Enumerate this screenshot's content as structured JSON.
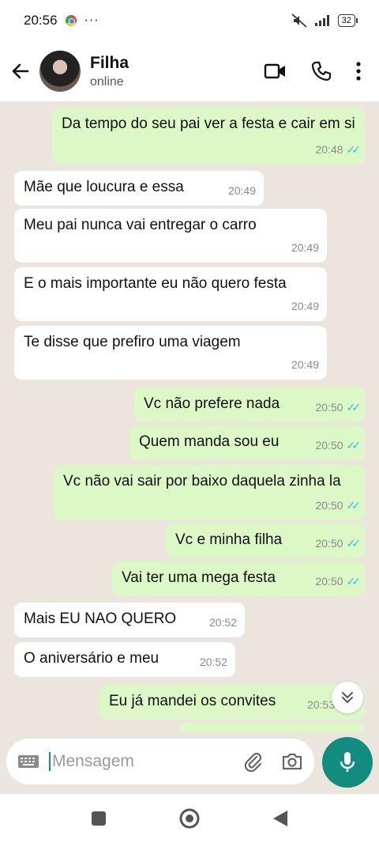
{
  "status_bar": {
    "time": "20:56",
    "dots": "···",
    "battery": "32"
  },
  "header": {
    "contact_name": "Filha",
    "contact_status": "online"
  },
  "messages": [
    {
      "dir": "out",
      "text": "Da tempo do seu pai ver a festa e cair em si",
      "time": "20:48",
      "ticks": "✓✓"
    },
    {
      "dir": "in",
      "text": "Mãe que loucura e essa",
      "time": "20:49"
    },
    {
      "dir": "in",
      "text": "Meu pai nunca vai entregar o carro",
      "time": "20:49"
    },
    {
      "dir": "in",
      "text": "E o mais importante eu não quero festa",
      "time": "20:49"
    },
    {
      "dir": "in",
      "text": "Te disse que prefiro uma viagem",
      "time": "20:49"
    },
    {
      "dir": "out",
      "text": "Vc não prefere nada",
      "time": "20:50",
      "ticks": "✓✓"
    },
    {
      "dir": "out",
      "text": "Quem manda sou eu",
      "time": "20:50",
      "ticks": "✓✓"
    },
    {
      "dir": "out",
      "text": "Vc não vai sair por baixo daquela zinha la",
      "time": "20:50",
      "ticks": "✓✓"
    },
    {
      "dir": "out",
      "text": "Vc e minha filha",
      "time": "20:50",
      "ticks": "✓✓"
    },
    {
      "dir": "out",
      "text": "Vai ter uma mega festa",
      "time": "20:50",
      "ticks": "✓✓"
    },
    {
      "dir": "in",
      "text": "Mais EU NAO QUERO",
      "time": "20:52"
    },
    {
      "dir": "in",
      "text": "O aniversário e meu",
      "time": "20:52"
    },
    {
      "dir": "out",
      "text": "Eu já mandei os convites",
      "time": "20:53"
    }
  ],
  "composer": {
    "placeholder": "Mensagem"
  },
  "colors": {
    "accent": "#128c7e",
    "outgoing": "#dcf8c6",
    "incoming": "#ffffff",
    "tick": "#34b7f1",
    "chat_bg": "#ece5dd"
  }
}
